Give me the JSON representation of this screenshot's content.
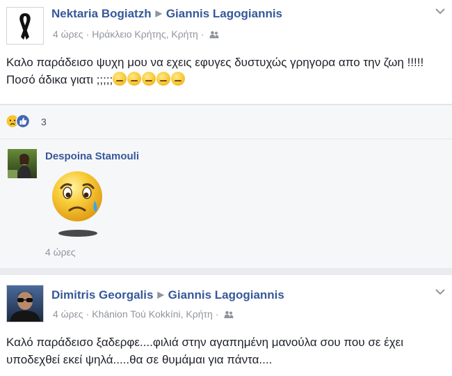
{
  "post1": {
    "author": "Nektaria Bogiatzh",
    "target": "Giannis Lagogiannis",
    "time": "4 ώρες",
    "location": "Ηράκλειο Κρήτης, Κρήτη",
    "text": "Καλο παράδεισο ψυχη μου να εχεις εφυγες δυστυχώς γρηγορα απο την ζωη !!!!! Ποσό άδικα γιατι ;;;;;",
    "emoji_count": 5,
    "audience_icon": "friends-icon",
    "menu_icon": "chevron-down-icon"
  },
  "reactions": {
    "count": "3",
    "icons": [
      "sad-reaction-icon",
      "like-reaction-icon"
    ]
  },
  "comment": {
    "author": "Despoina Stamouli",
    "time": "4 ώρες",
    "sticker": "crying-emoji-sticker"
  },
  "post2": {
    "author": "Dimitris Georgalis",
    "target": "Giannis Lagogiannis",
    "time": "4 ώρες",
    "location": "Khánion Toú Kokkíni, Κρήτη",
    "text": "Καλό παράδεισο ξαδερφε....φιλιά στην αγαπημένη μανούλα σου που σε έχει υποδεχθεί εκεί ψηλά.....θα σε θυμάμαι για πάντα....",
    "audience_icon": "friends-icon",
    "menu_icon": "chevron-down-icon"
  },
  "colors": {
    "link": "#365899",
    "meta": "#90949c",
    "text": "#1d2129",
    "like": "#4267b2",
    "sad": "#f7c52f"
  }
}
